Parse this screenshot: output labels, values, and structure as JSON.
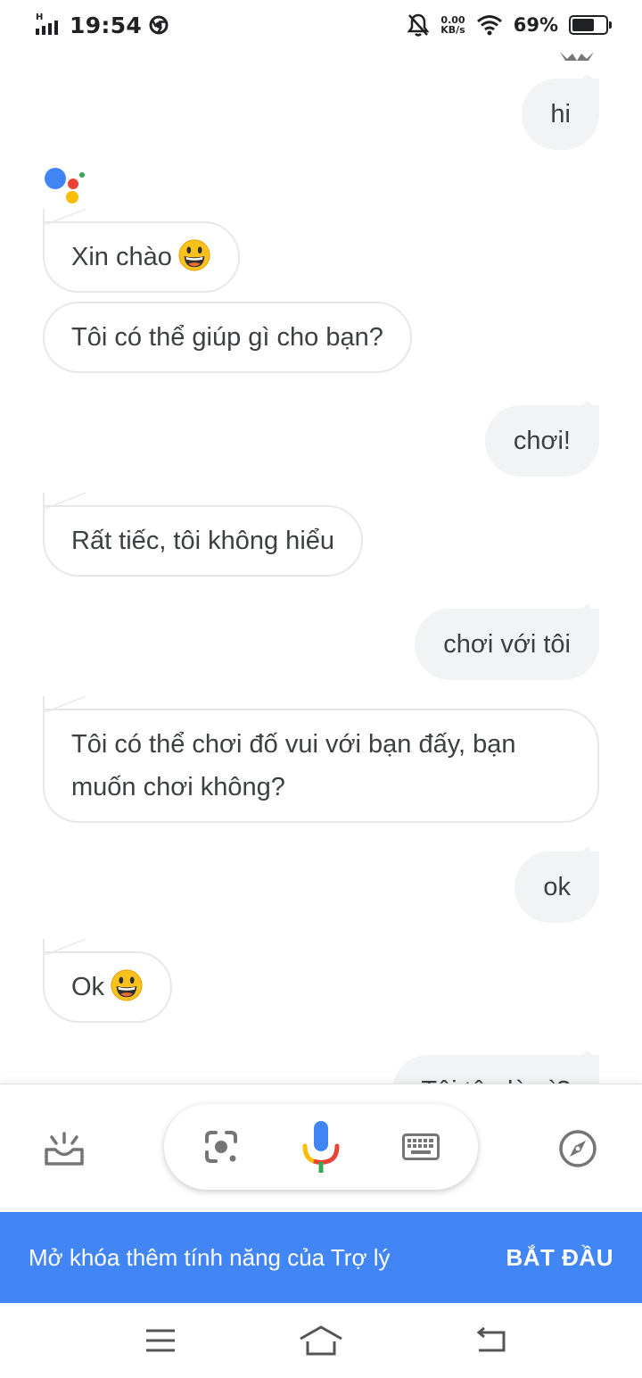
{
  "status_bar": {
    "network_type": "H",
    "time": "19:54",
    "net_speed_value": "0.00",
    "net_speed_unit": "KB/s",
    "battery_percent": "69%",
    "battery_level": 0.69
  },
  "chat": {
    "messages": [
      {
        "sender": "user",
        "text": "hi"
      },
      {
        "sender": "assistant",
        "text": "Xin chào",
        "emoji": "grinning-face"
      },
      {
        "sender": "assistant",
        "text": "Tôi có thể giúp gì cho bạn?"
      },
      {
        "sender": "user",
        "text": "chơi!"
      },
      {
        "sender": "assistant",
        "text": "Rất tiếc, tôi không hiểu"
      },
      {
        "sender": "user",
        "text": "chơi với tôi"
      },
      {
        "sender": "assistant",
        "text_line1": "Tôi có thể chơi đố vui với bạn đấy, bạn",
        "text_line2": "muốn chơi không?"
      },
      {
        "sender": "user",
        "text": "ok"
      },
      {
        "sender": "assistant",
        "text": "Ok",
        "emoji": "grinning-face"
      },
      {
        "sender": "user",
        "text": "Tôi tên là gì?",
        "partially_hidden": true
      }
    ]
  },
  "toolbar": {
    "left_icon": "updates-tray-icon",
    "lens_icon": "google-lens-icon",
    "mic_icon": "microphone-icon",
    "keyboard_icon": "keyboard-icon",
    "explore_icon": "compass-icon"
  },
  "banner": {
    "text": "Mở khóa thêm tính năng của Trợ lý",
    "button_label": "BẮT ĐẦU",
    "color": "#4285f4"
  },
  "nav_bar": {
    "menu_icon": "menu-icon",
    "home_icon": "home-icon",
    "back_icon": "back-icon"
  },
  "colors": {
    "google_blue": "#4285f4",
    "google_red": "#ea4335",
    "google_yellow": "#fbbc05",
    "google_green": "#34a853",
    "user_bubble": "#f1f3f4"
  }
}
